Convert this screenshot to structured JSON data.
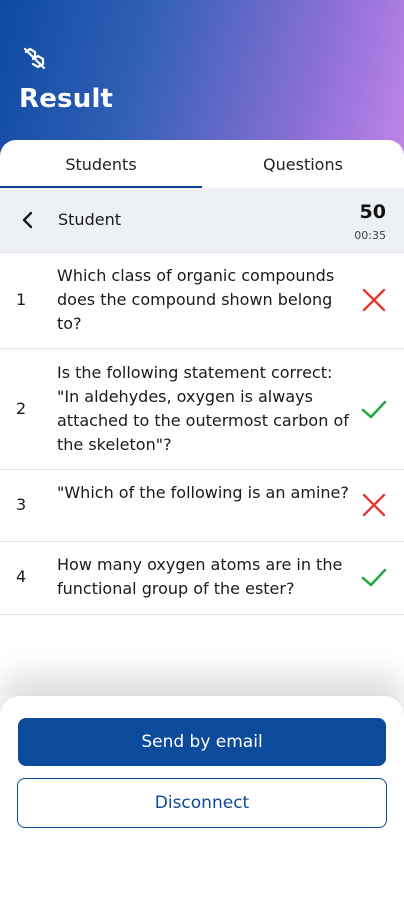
{
  "header": {
    "title": "Result",
    "logo_icon": "chemistry-logo-icon"
  },
  "tabs": [
    {
      "label": "Students",
      "selected": true
    },
    {
      "label": "Questions",
      "selected": false
    }
  ],
  "student": {
    "name": "Student",
    "score": "50",
    "time": "00:35",
    "back_icon": "chevron-left-icon"
  },
  "questions": [
    {
      "number": "1",
      "text": "Which class of organic compounds does the compound shown belong to?",
      "result": "incorrect",
      "icon": "cross-icon"
    },
    {
      "number": "2",
      "text": "Is the following statement correct: \"In aldehydes, oxygen is always attached to the outermost carbon of the skeleton\"?",
      "result": "correct",
      "icon": "check-icon"
    },
    {
      "number": "3",
      "text": "\"Which of the following is an amine?",
      "result": "incorrect",
      "icon": "cross-icon"
    },
    {
      "number": "4",
      "text": "How many oxygen atoms are in the functional group of the ester?",
      "result": "correct",
      "icon": "check-icon"
    }
  ],
  "actions": {
    "send_email": "Send by email",
    "disconnect": "Disconnect"
  },
  "colors": {
    "primary": "#0c4a9b",
    "correct": "#27a84a",
    "incorrect": "#e53935"
  }
}
